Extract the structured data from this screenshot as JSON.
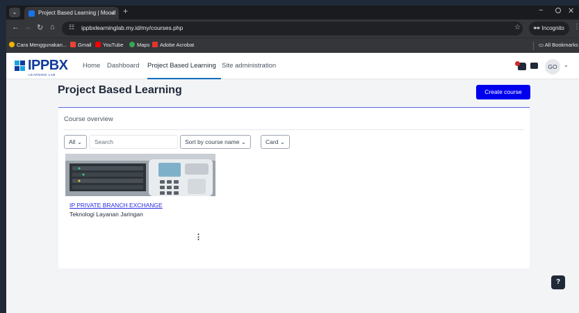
{
  "browser": {
    "tab_title": "Project Based Learning | Moodl",
    "tab_close": "×",
    "new_tab": "+",
    "url": "ippbxlearninglab.my.id/my/courses.php",
    "incognito_label": "Incognito",
    "bookmarks": [
      {
        "label": "Cara Menggunakan...",
        "color": "#f4b400"
      },
      {
        "label": "Gmail",
        "color": "#ea4335"
      },
      {
        "label": "YouTube",
        "color": "#ff0000"
      },
      {
        "label": "Maps",
        "color": "#34a853"
      },
      {
        "label": "Adobe Acrobat",
        "color": "#e3342f"
      }
    ],
    "all_bookmarks": "All Bookmarks"
  },
  "site": {
    "logo_text": "IPPBX",
    "logo_sub": "LEARNING LAB",
    "nav": [
      "Home",
      "Dashboard",
      "Project Based Learning",
      "Site administration"
    ],
    "active_nav": "Project Based Learning",
    "user_initials": "GO"
  },
  "page": {
    "title": "Project Based Learning",
    "create_button": "Create course"
  },
  "overview": {
    "title": "Course overview",
    "filter": "All",
    "search_placeholder": "Search",
    "sort": "Sort by course name",
    "view": "Card",
    "courses": [
      {
        "name": "IP PRIVATE BRANCH EXCHANGE",
        "category": "Teknologi Layanan Jaringan"
      }
    ]
  },
  "help_label": "?",
  "colors": {
    "accent": "#0000ee",
    "logo": "#0f3b9c"
  }
}
